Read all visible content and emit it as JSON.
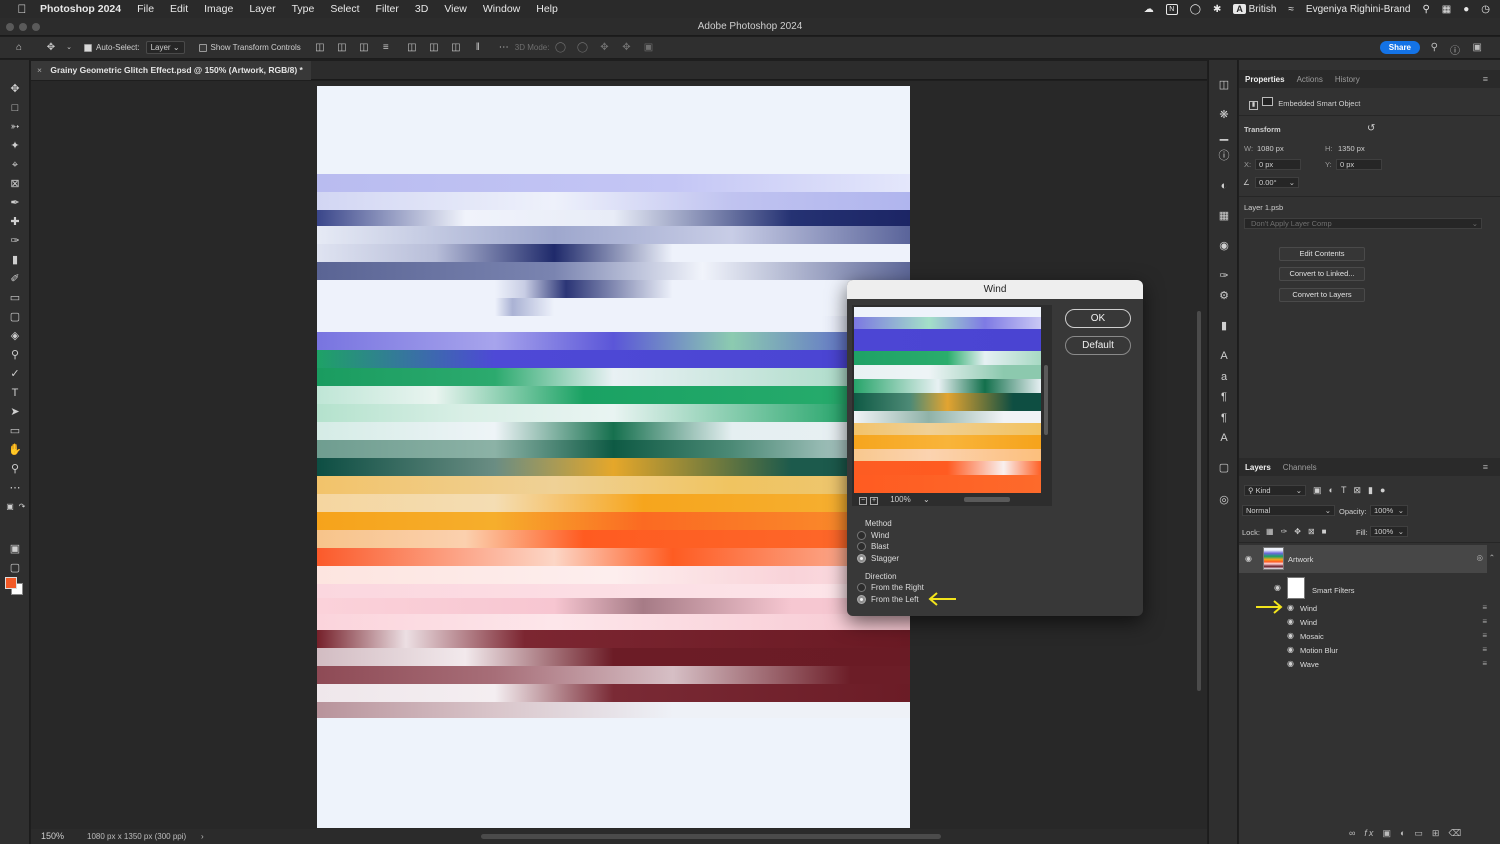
{
  "menubar": {
    "app": "Photoshop 2024",
    "items": [
      "File",
      "Edit",
      "Image",
      "Layer",
      "Type",
      "Select",
      "Filter",
      "3D",
      "View",
      "Window",
      "Help"
    ],
    "input_badge": "A",
    "input_source": "British",
    "n_badge": "N",
    "user": "Evgeniya Righini-Brand"
  },
  "window": {
    "title": "Adobe Photoshop 2024"
  },
  "options": {
    "auto_select": "Auto-Select:",
    "layer_select": "Layer",
    "transform_controls": "Show Transform Controls",
    "mode_3d": "3D Mode:",
    "share": "Share"
  },
  "document": {
    "tab_title": "Grainy Geometric Glitch Effect.psd @ 150% (Artwork, RGB/8) *",
    "zoom": "150%",
    "info": "1080 px x 1350 px (300 ppi)"
  },
  "properties": {
    "tabs": [
      "Properties",
      "Actions",
      "History"
    ],
    "object_type": "Embedded Smart Object",
    "transform_label": "Transform",
    "w_label": "W:",
    "w": "1080 px",
    "h_label": "H:",
    "h": "1350 px",
    "x_label": "X:",
    "x": "0 px",
    "y_label": "Y:",
    "y": "0 px",
    "angle": "0.00°",
    "layer_file": "Layer 1.psb",
    "layer_comp": "Don't Apply Layer Comp",
    "buttons": [
      "Edit Contents",
      "Convert to Linked...",
      "Convert to Layers"
    ]
  },
  "layers": {
    "tabs": [
      "Layers",
      "Channels"
    ],
    "kind": "Kind",
    "blend_mode": "Normal",
    "opacity_label": "Opacity:",
    "opacity": "100%",
    "lock_label": "Lock:",
    "fill_label": "Fill:",
    "fill": "100%",
    "artwork": "Artwork",
    "smart_filters": "Smart Filters",
    "filters": [
      "Wind",
      "Wind",
      "Mosaic",
      "Motion Blur",
      "Wave"
    ],
    "bottom_fx": "fx"
  },
  "wind_dialog": {
    "title": "Wind",
    "ok": "OK",
    "default": "Default",
    "preview_zoom": "100%",
    "method_label": "Method",
    "methods": [
      "Wind",
      "Blast",
      "Stagger"
    ],
    "selected_method": "Stagger",
    "direction_label": "Direction",
    "directions": [
      "From the Right",
      "From the Left"
    ],
    "selected_direction": "From the Left"
  },
  "colors": {
    "foreground": "#f35a27",
    "background": "#ffffff",
    "accent": "#1473e6",
    "annotation": "#f2e41c"
  },
  "icons": [
    "apple-icon",
    "move-icon",
    "marquee-icon",
    "lasso-icon",
    "magic-wand-icon",
    "crop-icon",
    "eyedropper-icon",
    "brush-icon",
    "stamp-icon",
    "eraser-icon",
    "gradient-icon",
    "pen-icon",
    "type-icon",
    "hand-icon",
    "zoom-icon",
    "eye-icon"
  ]
}
